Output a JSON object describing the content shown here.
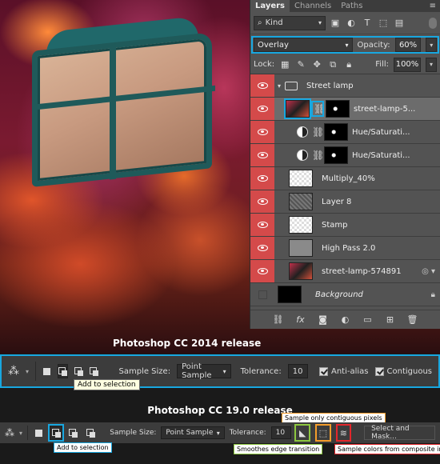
{
  "panel": {
    "tabs": [
      "Layers",
      "Channels",
      "Paths"
    ],
    "filter_kind": "Kind",
    "blend_mode": "Overlay",
    "opacity_label": "Opacity:",
    "opacity_value": "60%",
    "lock_label": "Lock:",
    "fill_label": "Fill:",
    "fill_value": "100%",
    "layers": [
      {
        "name": "Street lamp",
        "type": "group"
      },
      {
        "name": "street-lamp-5...",
        "type": "smart-masked"
      },
      {
        "name": "Hue/Saturati...",
        "type": "adjustment"
      },
      {
        "name": "Hue/Saturati...",
        "type": "adjustment"
      },
      {
        "name": "Multiply_40%",
        "type": "layer"
      },
      {
        "name": "Layer 8",
        "type": "layer"
      },
      {
        "name": "Stamp",
        "type": "layer"
      },
      {
        "name": "High Pass 2.0",
        "type": "layer"
      },
      {
        "name": "street-lamp-574891",
        "type": "smart"
      },
      {
        "name": "Background",
        "type": "background"
      }
    ]
  },
  "captions": {
    "old": "Photoshop CC 2014 release",
    "new": "Photoshop CC 19.0 release"
  },
  "options_2014": {
    "sample_size_label": "Sample Size:",
    "sample_size_value": "Point Sample",
    "tolerance_label": "Tolerance:",
    "tolerance_value": "10",
    "anti_alias": "Anti-alias",
    "contiguous": "Contiguous",
    "tooltip": "Add to selection"
  },
  "options_2019": {
    "sample_size_label": "Sample Size:",
    "sample_size_value": "Point Sample",
    "tolerance_label": "Tolerance:",
    "tolerance_value": "10",
    "select_and_mask": "Select and Mask...",
    "tooltip": "Add to selection"
  },
  "annotations": {
    "contiguous": "Sample only contiguous pixels",
    "smoothes": "Smoothes edge transition",
    "composite": "Sample colors from composite image"
  },
  "colors": {
    "highlight_blue": "#18a7e0",
    "highlight_green": "#8cc63f",
    "highlight_orange": "#f39c2a",
    "highlight_red": "#e3262b",
    "visibility_red": "#d44a4a"
  }
}
